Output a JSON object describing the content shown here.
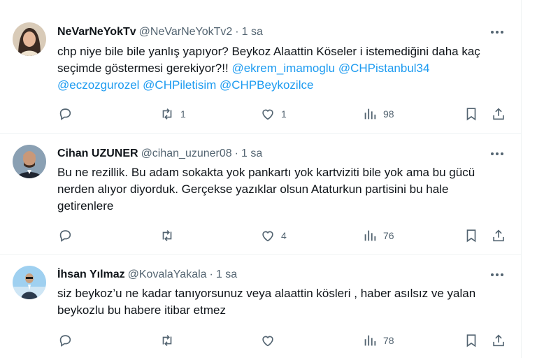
{
  "tweets": [
    {
      "name": "NeVarNeYokTv",
      "handle": "@NeVarNeYokTv2",
      "time": "1 sa",
      "text_parts": [
        {
          "t": "chp niye bile bile yanlış yapıyor? Beykoz Alaattin Köseler i istemediğini daha kaç seçimde göstermesi gerekiyor?!! "
        },
        {
          "t": "@ekrem_imamoglu",
          "m": true
        },
        {
          "t": " "
        },
        {
          "t": "@CHPistanbul34",
          "m": true
        },
        {
          "t": " "
        },
        {
          "t": "@eczozgurozel",
          "m": true
        },
        {
          "t": " "
        },
        {
          "t": "@CHPiletisim",
          "m": true
        },
        {
          "t": " "
        },
        {
          "t": "@CHPBeykozilce",
          "m": true
        }
      ],
      "replies": "",
      "retweets": "1",
      "likes": "1",
      "views": "98"
    },
    {
      "name": "Cihan UZUNER",
      "handle": "@cihan_uzuner08",
      "time": "1 sa",
      "text_parts": [
        {
          "t": "Bu ne rezillik. Bu adam sokakta yok pankartı yok kartviziti bile yok ama bu gücü nerden alıyor diyorduk. Gerçekse yazıklar olsun Ataturkun partisini bu hale getirenlere"
        }
      ],
      "replies": "",
      "retweets": "",
      "likes": "4",
      "views": "76"
    },
    {
      "name": "İhsan Yılmaz",
      "handle": "@KovalaYakala",
      "time": "1 sa",
      "text_parts": [
        {
          "t": "siz beykoz’u ne kadar tanıyorsunuz veya alaattin kösleri , haber asılsız ve yalan beykozlu bu habere itibar etmez"
        }
      ],
      "replies": "",
      "retweets": "",
      "likes": "",
      "views": "78"
    }
  ],
  "colors": {
    "mention": "#1d9bf0",
    "muted": "#536471",
    "text": "#0f1419",
    "divider": "#eff3f4"
  },
  "icons": [
    "reply-icon",
    "retweet-icon",
    "like-icon",
    "views-icon",
    "bookmark-icon",
    "share-icon",
    "more-icon"
  ]
}
